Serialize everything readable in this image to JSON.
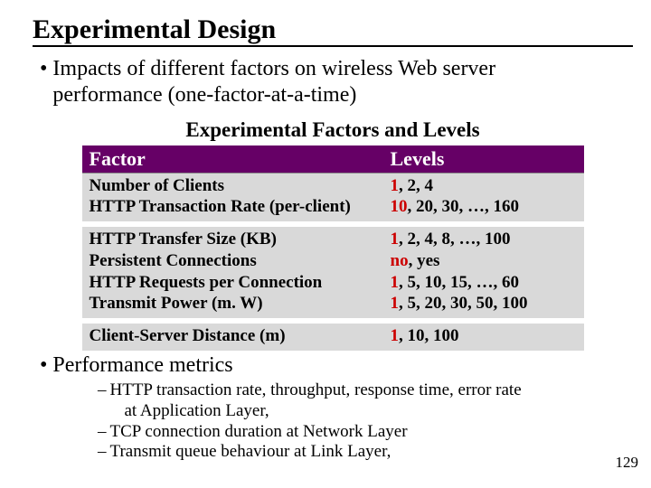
{
  "title": "Experimental Design",
  "bullet1_line1": "Impacts of different factors on wireless Web server",
  "bullet1_line2": "performance (one-factor-at-a-time)",
  "table_caption": "Experimental Factors and Levels",
  "header": {
    "factor": "Factor",
    "levels": "Levels"
  },
  "rows": [
    {
      "factor": "Number of Clients",
      "base": "1",
      "rest": ", 2, 4"
    },
    {
      "factor": "HTTP Transaction Rate (per-client)",
      "base": "10",
      "rest": ", 20, 30, …, 160"
    },
    {
      "factor": "HTTP Transfer Size (KB)",
      "base": "1",
      "rest": ", 2, 4, 8, …, 100"
    },
    {
      "factor": "Persistent Connections",
      "base": "no",
      "rest": ", yes"
    },
    {
      "factor": "HTTP Requests per Connection",
      "base": "1",
      "rest": ", 5, 10, 15, …, 60"
    },
    {
      "factor": "Transmit Power (m. W)",
      "base": "1",
      "rest": ", 5, 20, 30, 50, 100"
    },
    {
      "factor": "Client-Server Distance (m)",
      "base": "1",
      "rest": ", 10, 100"
    }
  ],
  "bullet2": "Performance metrics",
  "subs": [
    {
      "l1": "HTTP transaction rate, throughput, response time, error rate",
      "l2": "at Application Layer,"
    },
    {
      "l1": "TCP connection duration at Network Layer"
    },
    {
      "l1": "Transmit queue behaviour at Link Layer,"
    }
  ],
  "page_number": "129"
}
